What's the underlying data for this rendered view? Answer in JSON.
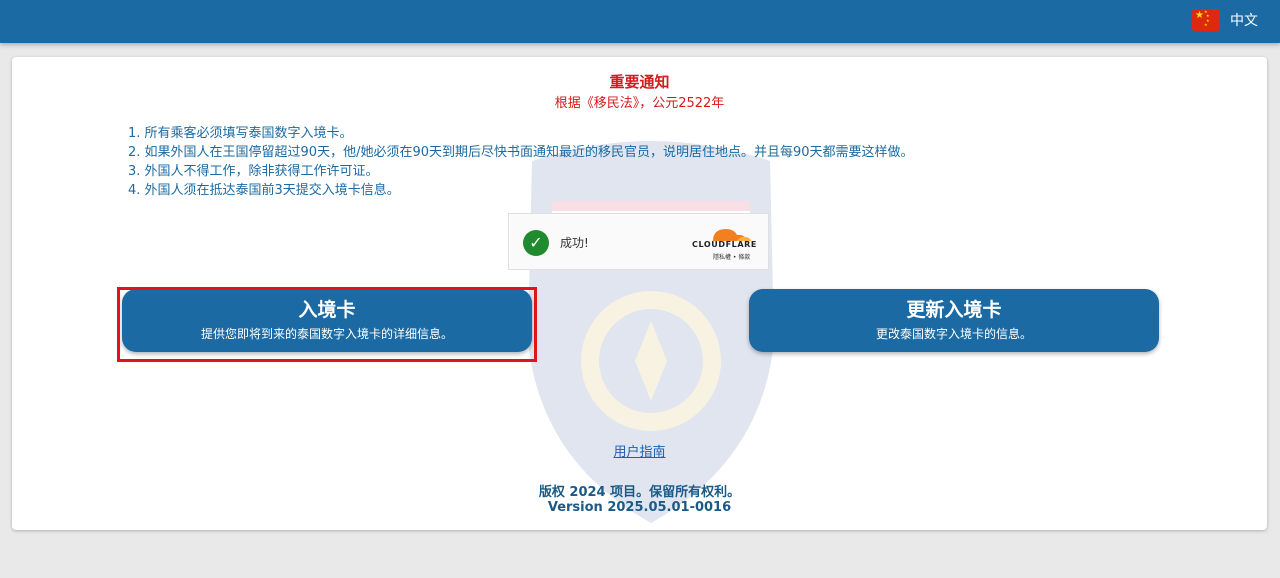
{
  "header": {
    "language": {
      "label": "中文",
      "flag_icon": "china-flag-icon"
    }
  },
  "notice": {
    "title": "重要通知",
    "subtitle": "根据《移民法》，公元2522年",
    "rules": [
      "1. 所有乘客必须填写泰国数字入境卡。",
      "2. 如果外国人在王国停留超过90天，他/她必须在90天到期后尽快书面通知最近的移民官员，说明居住地点。并且每90天都需要这样做。",
      "3. 外国人不得工作，除非获得工作许可证。",
      "4. 外国人须在抵达泰国前3天提交入境卡信息。"
    ]
  },
  "captcha": {
    "status": "成功!",
    "provider": "CLOUDFLARE",
    "links": "隱私權 • 條款"
  },
  "buttons": {
    "entry_card": {
      "title": "入境卡",
      "description": "提供您即将到来的泰国数字入境卡的详细信息。"
    },
    "update_card": {
      "title": "更新入境卡",
      "description": "更改泰国数字入境卡的信息。"
    }
  },
  "footer": {
    "guide_link": "用户指南",
    "copyright": "版权 2024 项目。保留所有权利。",
    "version": "Version 2025.05.01-0016"
  },
  "colors": {
    "primary": "#1b6aa3",
    "notice_red": "#d41a1a",
    "highlight_red": "#e0141c",
    "success_green": "#1f8a2e",
    "cloudflare_orange": "#f38020"
  }
}
